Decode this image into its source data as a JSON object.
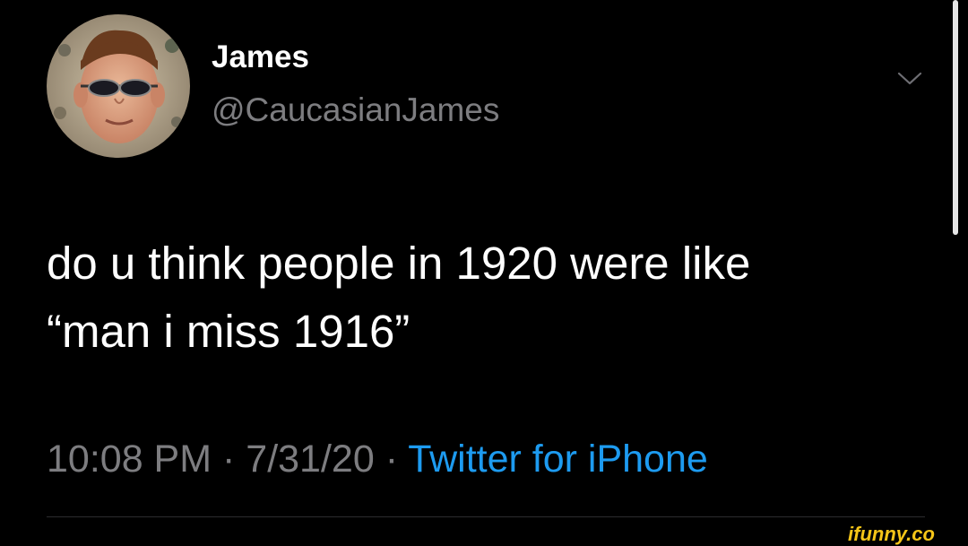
{
  "tweet": {
    "author": {
      "display_name": "James",
      "handle": "@CaucasianJames",
      "avatar_icon": "profile-photo"
    },
    "text_lines": [
      "do u think people in 1920 were like",
      "“man i miss 1916”"
    ],
    "meta": {
      "time": "10:08 PM",
      "separator": " · ",
      "date": "7/31/20",
      "source": "Twitter for iPhone"
    },
    "menu_icon": "chevron-down-icon"
  },
  "watermark": {
    "text": "ifunny.co"
  },
  "colors": {
    "background": "#000000",
    "primary_text": "#ffffff",
    "secondary_text": "#7d7d80",
    "link": "#1d9bf0",
    "watermark": "#f5c518"
  }
}
